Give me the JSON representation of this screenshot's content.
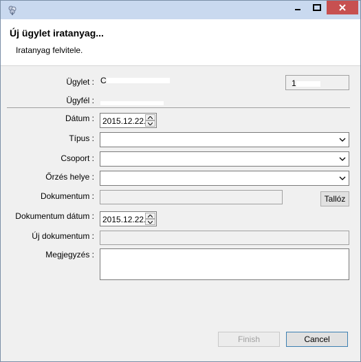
{
  "window": {
    "minimize_label": "Minimize",
    "maximize_label": "Maximize",
    "close_label": "Close",
    "app_icon": "key-flower-icon"
  },
  "header": {
    "title": "Új ügylet iratanyag...",
    "subtitle": "Iratanyag felvitele."
  },
  "form": {
    "ugylet": {
      "label": "Ügylet :",
      "value": "C",
      "right_value": "1"
    },
    "ugyfel": {
      "label": "Ügyfél :"
    },
    "datum": {
      "label": "Dátum :",
      "value": "2015.12.22."
    },
    "tipus": {
      "label": "Típus :",
      "value": ""
    },
    "csoport": {
      "label": "Csoport :",
      "value": ""
    },
    "orzes_helye": {
      "label": "Őrzés helye :",
      "value": ""
    },
    "dokumentum": {
      "label": "Dokumentum :",
      "value": "",
      "browse_label": "Tallóz"
    },
    "dokumentum_datum": {
      "label": "Dokumentum dátum :",
      "value": "2015.12.22."
    },
    "uj_dokumentum": {
      "label": "Új dokumentum :",
      "value": ""
    },
    "megjegyzes": {
      "label": "Megjegyzés :",
      "value": ""
    }
  },
  "footer": {
    "finish_label": "Finish",
    "cancel_label": "Cancel"
  }
}
